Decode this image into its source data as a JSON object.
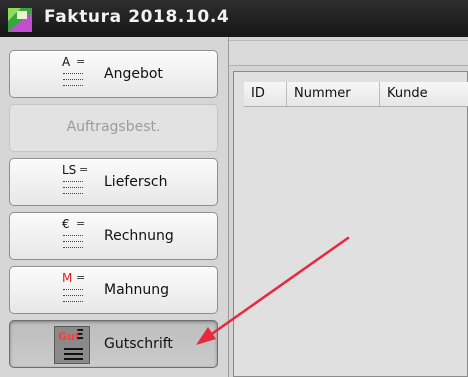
{
  "window": {
    "title": "Faktura 2018.10.4",
    "logo_icon": "app-logo-icon"
  },
  "sidebar": {
    "buttons": [
      {
        "name": "angebot",
        "code": "A",
        "label": "Angebot",
        "enabled": true
      },
      {
        "name": "auftragsbest",
        "code": "",
        "label": "Auftragsbest.",
        "enabled": false
      },
      {
        "name": "lieferschein",
        "code": "LS",
        "label": "Liefersch",
        "enabled": true
      },
      {
        "name": "rechnung",
        "code": "€",
        "label": "Rechnung",
        "enabled": true
      },
      {
        "name": "mahnung",
        "code": "M",
        "label": "Mahnung",
        "enabled": true,
        "code_color": "#e02020"
      },
      {
        "name": "gutschrift",
        "code": "Gut",
        "label": "Gutschrift",
        "enabled": true,
        "active": true,
        "code_color": "#ff3b3b"
      }
    ]
  },
  "table": {
    "columns": [
      "ID",
      "Nummer",
      "Kunde"
    ],
    "rows": []
  },
  "annotation": {
    "arrow_color": "#e8283c"
  }
}
